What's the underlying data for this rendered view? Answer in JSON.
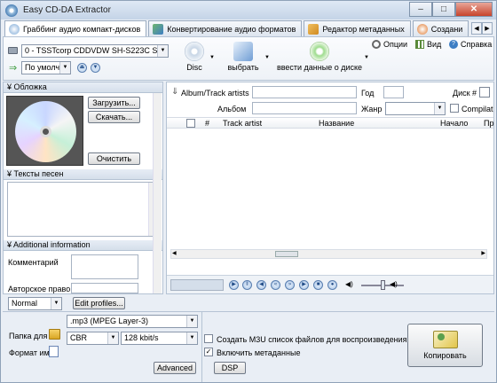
{
  "window": {
    "title": "Easy CD-DA Extractor",
    "min": "–",
    "max": "□",
    "close": "✕"
  },
  "tabs": [
    {
      "label": "Граббинг аудио компакт-дисков",
      "active": true,
      "icon": "disc-icon"
    },
    {
      "label": "Конвертирование аудио форматов",
      "icon": "convert-icon"
    },
    {
      "label": "Редактор метаданных",
      "icon": "tag-icon"
    },
    {
      "label": "Создани",
      "icon": "burn-icon"
    }
  ],
  "toolbar": {
    "drive": "0 - TSSTcorp CDDVDW SH-S223C SB04",
    "speed": "По умолч",
    "disc_label": "Disc",
    "select_label": "выбрать",
    "enter_data_label": "ввести данные о диске",
    "options_label": "Опции",
    "view_label": "Вид",
    "help_label": "Справка"
  },
  "left": {
    "cover_header": "Обложка",
    "load_btn": "Загрузить...",
    "download_btn": "Скачать...",
    "clear_btn": "Очистить",
    "lyrics_header": "Тексты песен",
    "additional_header": "Additional information",
    "comment_label": "Комментарий",
    "copyright_label": "Авторское право"
  },
  "meta": {
    "album_artist_label": "Album/Track artists",
    "year_label": "Год",
    "disc_num_label": "Диск #",
    "album_label": "Альбом",
    "genre_label": "Жанр",
    "compilation_label": "Compilat"
  },
  "columns": {
    "num": "#",
    "track_artist": "Track artist",
    "name": "Название",
    "start": "Начало",
    "pr": "Пр"
  },
  "bottom": {
    "profile": "Normal",
    "edit_profiles": "Edit profiles...",
    "format": ".mp3 (MPEG Layer-3)",
    "mode": "CBR",
    "bitrate": "128 kbit/s",
    "folder_label": "Папка для",
    "filename_label": "Формат им",
    "m3u_label": "Создать M3U список файлов для воспроизведения",
    "m3u_checked": false,
    "metadata_label": "Включить метаданные",
    "metadata_checked": true,
    "advanced_btn": "Advanced",
    "dsp_btn": "DSP",
    "copy_btn": "Копировать"
  }
}
